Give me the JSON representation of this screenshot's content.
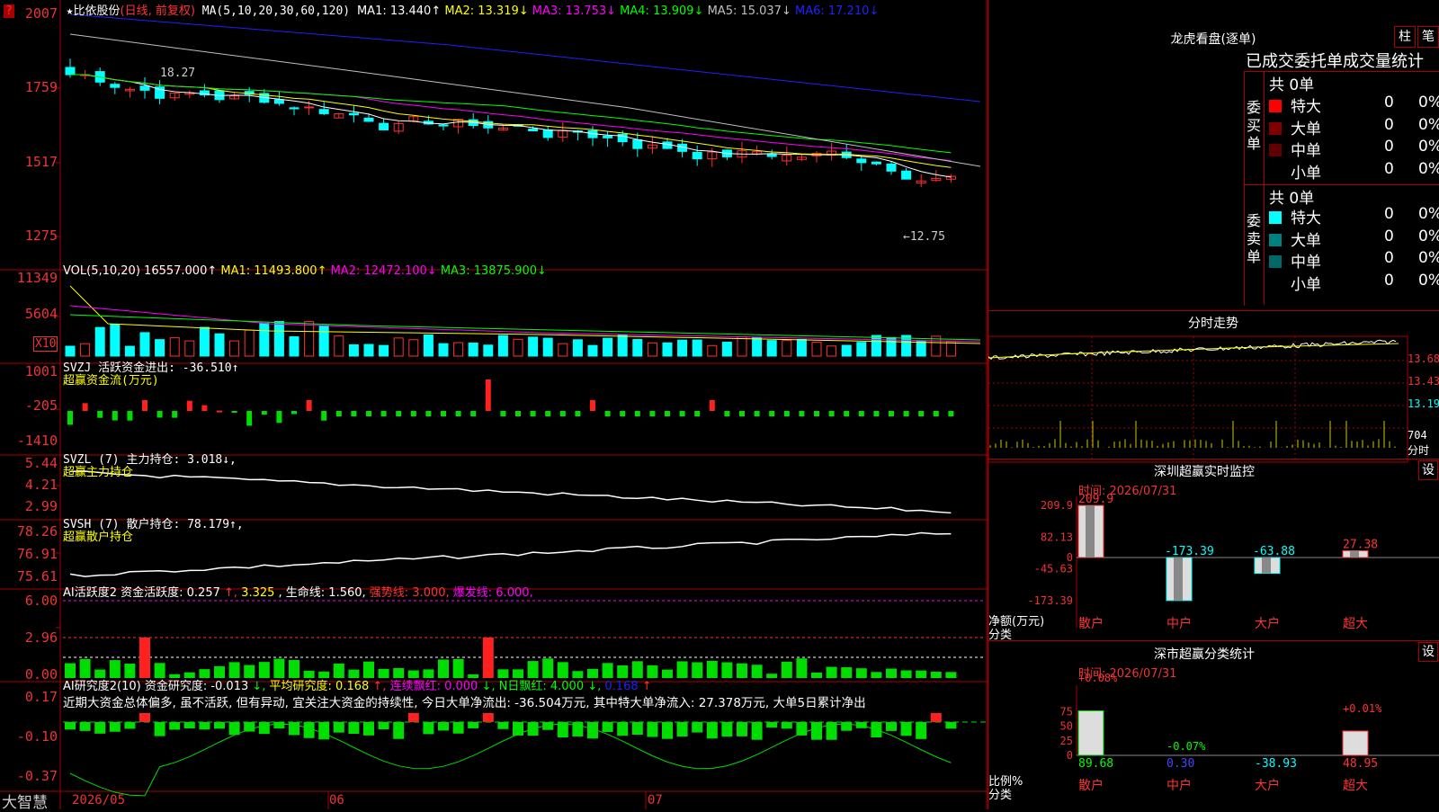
{
  "header": {
    "star": "★",
    "name": "比依股份",
    "period": "(日线, 前复权)",
    "ma_label": "MA(5,10,20,30,60,120)",
    "ma": [
      {
        "text": "MA1: 13.440↑",
        "color": "#ffffff"
      },
      {
        "text": "MA2: 13.319↓",
        "color": "#ffff00"
      },
      {
        "text": "MA3: 13.753↓",
        "color": "#ff00ff"
      },
      {
        "text": "MA4: 13.909↓",
        "color": "#00ff00"
      },
      {
        "text": "MA5: 15.037↓",
        "color": "#c0c0c0"
      },
      {
        "text": "MA6: 17.210↓",
        "color": "#2020ff"
      }
    ],
    "left_marker": "?"
  },
  "price_axis": [
    "2007",
    "1759",
    "1517",
    "1275"
  ],
  "price_annotations": {
    "high": "18.27",
    "low": "←12.75"
  },
  "vol": {
    "axis": [
      "11349",
      "5604",
      "X10"
    ],
    "head": [
      {
        "text": "VOL(5,10,20)",
        "color": "#ffffff"
      },
      {
        "text": "16557.000↑",
        "color": "#ffffff"
      },
      {
        "text": "MA1: 11493.800↑",
        "color": "#ffff00"
      },
      {
        "text": "MA2: 12472.100↓",
        "color": "#ff00ff"
      },
      {
        "text": "MA3: 13875.900↓",
        "color": "#00ff00"
      }
    ]
  },
  "svzj": {
    "axis": [
      "1001",
      "-205",
      "-1410"
    ],
    "head": "SVZJ  活跃资金进出: -36.510↑",
    "sub": "超赢资金流(万元)"
  },
  "svzl": {
    "axis": [
      "5.44",
      "4.21",
      "2.99"
    ],
    "head": "SVZL (7) 主力持仓: 3.018↓,",
    "sub": "超赢主力持仓"
  },
  "svsh": {
    "axis": [
      "78.26",
      "76.91",
      "75.61"
    ],
    "head": "SVSH (7) 散户持仓: 78.179↑,",
    "sub": "超赢散户持仓"
  },
  "ai1": {
    "axis": [
      "6.00",
      "2.96",
      "0.00"
    ],
    "head": [
      {
        "text": "AI活跃度2 资金活跃度: 0.257",
        "color": "#ffffff"
      },
      {
        "text": "↑, ",
        "color": "#ff3333"
      },
      {
        "text": "3.325",
        "color": "#ffff00"
      },
      {
        "text": ", 生命线: 1.560,",
        "color": "#ffffff"
      },
      {
        "text": " 强势线: 3.000,",
        "color": "#ff3333"
      },
      {
        "text": " 爆发线: 6.000,",
        "color": "#ff00ff"
      }
    ]
  },
  "ai2": {
    "axis": [
      "0.17",
      "-0.10",
      "-0.37"
    ],
    "head": [
      {
        "text": "AI研究度2(10) 资金研究度: -0.013",
        "color": "#ffffff"
      },
      {
        "text": "↓, ",
        "color": "#00ff00"
      },
      {
        "text": "平均研究度: 0.168",
        "color": "#ffff00"
      },
      {
        "text": "↑, ",
        "color": "#ff3333"
      },
      {
        "text": "连续飘红: 0.000",
        "color": "#ff00ff"
      },
      {
        "text": "↓, ",
        "color": "#00ff00"
      },
      {
        "text": "N日飘红: 4.000",
        "color": "#00ff00"
      },
      {
        "text": "↓, ",
        "color": "#00ff00"
      },
      {
        "text": "0.168",
        "color": "#2020ff"
      },
      {
        "text": "↑",
        "color": "#ff3333"
      }
    ],
    "comment": "近期大资金总体偏多, 虽不活跃, 但有异动, 宜关注大资金的持续性, 今日大单净流出: -36.504万元, 其中特大单净流入: 27.378万元, 大单5日累计净出"
  },
  "bottom": {
    "brand": "大智慧",
    "dates": [
      "2026/05",
      "06",
      "07"
    ]
  },
  "right": {
    "lhb_title": "龙虎看盘(逐单)",
    "tab1": "柱",
    "tab2": "笔",
    "stat_title": "已成交委托单成交量统计",
    "buy_label": "委买单",
    "sell_label": "委卖单",
    "buy_total": "共 0单",
    "sell_total": "共 0单",
    "buy_rows": [
      {
        "label": "特大",
        "count": "0",
        "pct": "0%",
        "color": "#ff0000"
      },
      {
        "label": "大单",
        "count": "0",
        "pct": "0%",
        "color": "#800000"
      },
      {
        "label": "中单",
        "count": "0",
        "pct": "0%",
        "color": "#600000"
      },
      {
        "label": "小单",
        "count": "0",
        "pct": "0%",
        "color": "#000000"
      }
    ],
    "sell_rows": [
      {
        "label": "特大",
        "count": "0",
        "pct": "0%",
        "color": "#00ffff"
      },
      {
        "label": "大单",
        "count": "0",
        "pct": "0%",
        "color": "#008080"
      },
      {
        "label": "中单",
        "count": "0",
        "pct": "0%",
        "color": "#006868"
      },
      {
        "label": "小单",
        "count": "0",
        "pct": "0%",
        "color": "#000000"
      }
    ],
    "fs_title": "分时走势",
    "fs_axis": [
      "13.68",
      "13.43",
      "13.19",
      "704",
      "分时"
    ],
    "mon_title": "深圳超赢实时监控",
    "mon_btn": "设",
    "mon_time": "时间: 2026/07/31",
    "mon_axis": [
      "209.9",
      "82.13",
      "0",
      "-45.63",
      "-173.39"
    ],
    "mon_vals": [
      "209.9",
      "-173.39",
      "-63.88",
      "27.38"
    ],
    "mon_side": [
      "净额(万元)",
      "分类"
    ],
    "mon_cats": [
      "散户",
      "中户",
      "大户",
      "超大"
    ],
    "cls_title": "深市超赢分类统计",
    "cls_btn": "设",
    "cls_time": "时间: 2026/07/31",
    "cls_axis": [
      "75",
      "50",
      "25",
      "0"
    ],
    "cls_top": [
      "+0.08%",
      "-0.07%",
      "+0.01%"
    ],
    "cls_vals": [
      "89.68",
      "0.30",
      "-38.93",
      "48.95"
    ],
    "cls_side": [
      "比例%",
      "分类"
    ],
    "cls_cats": [
      "散户",
      "中户",
      "大户",
      "超大"
    ]
  }
}
